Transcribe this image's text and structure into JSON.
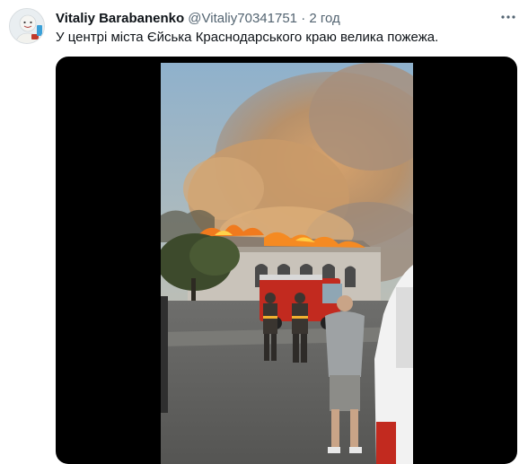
{
  "tweet": {
    "author_name": "Vitaliy Barabanenko",
    "author_handle": "@Vitaliy70341751",
    "separator": "·",
    "time": "2 год",
    "text": "У центрі міста Єйська Краснодарського краю велика пожежа."
  },
  "icons": {
    "more": "more-dots-icon"
  },
  "colors": {
    "text_primary": "#0f1419",
    "text_secondary": "#536471",
    "media_background": "#000000",
    "fire": "#f07a1e",
    "smoke": "#b8916a"
  }
}
